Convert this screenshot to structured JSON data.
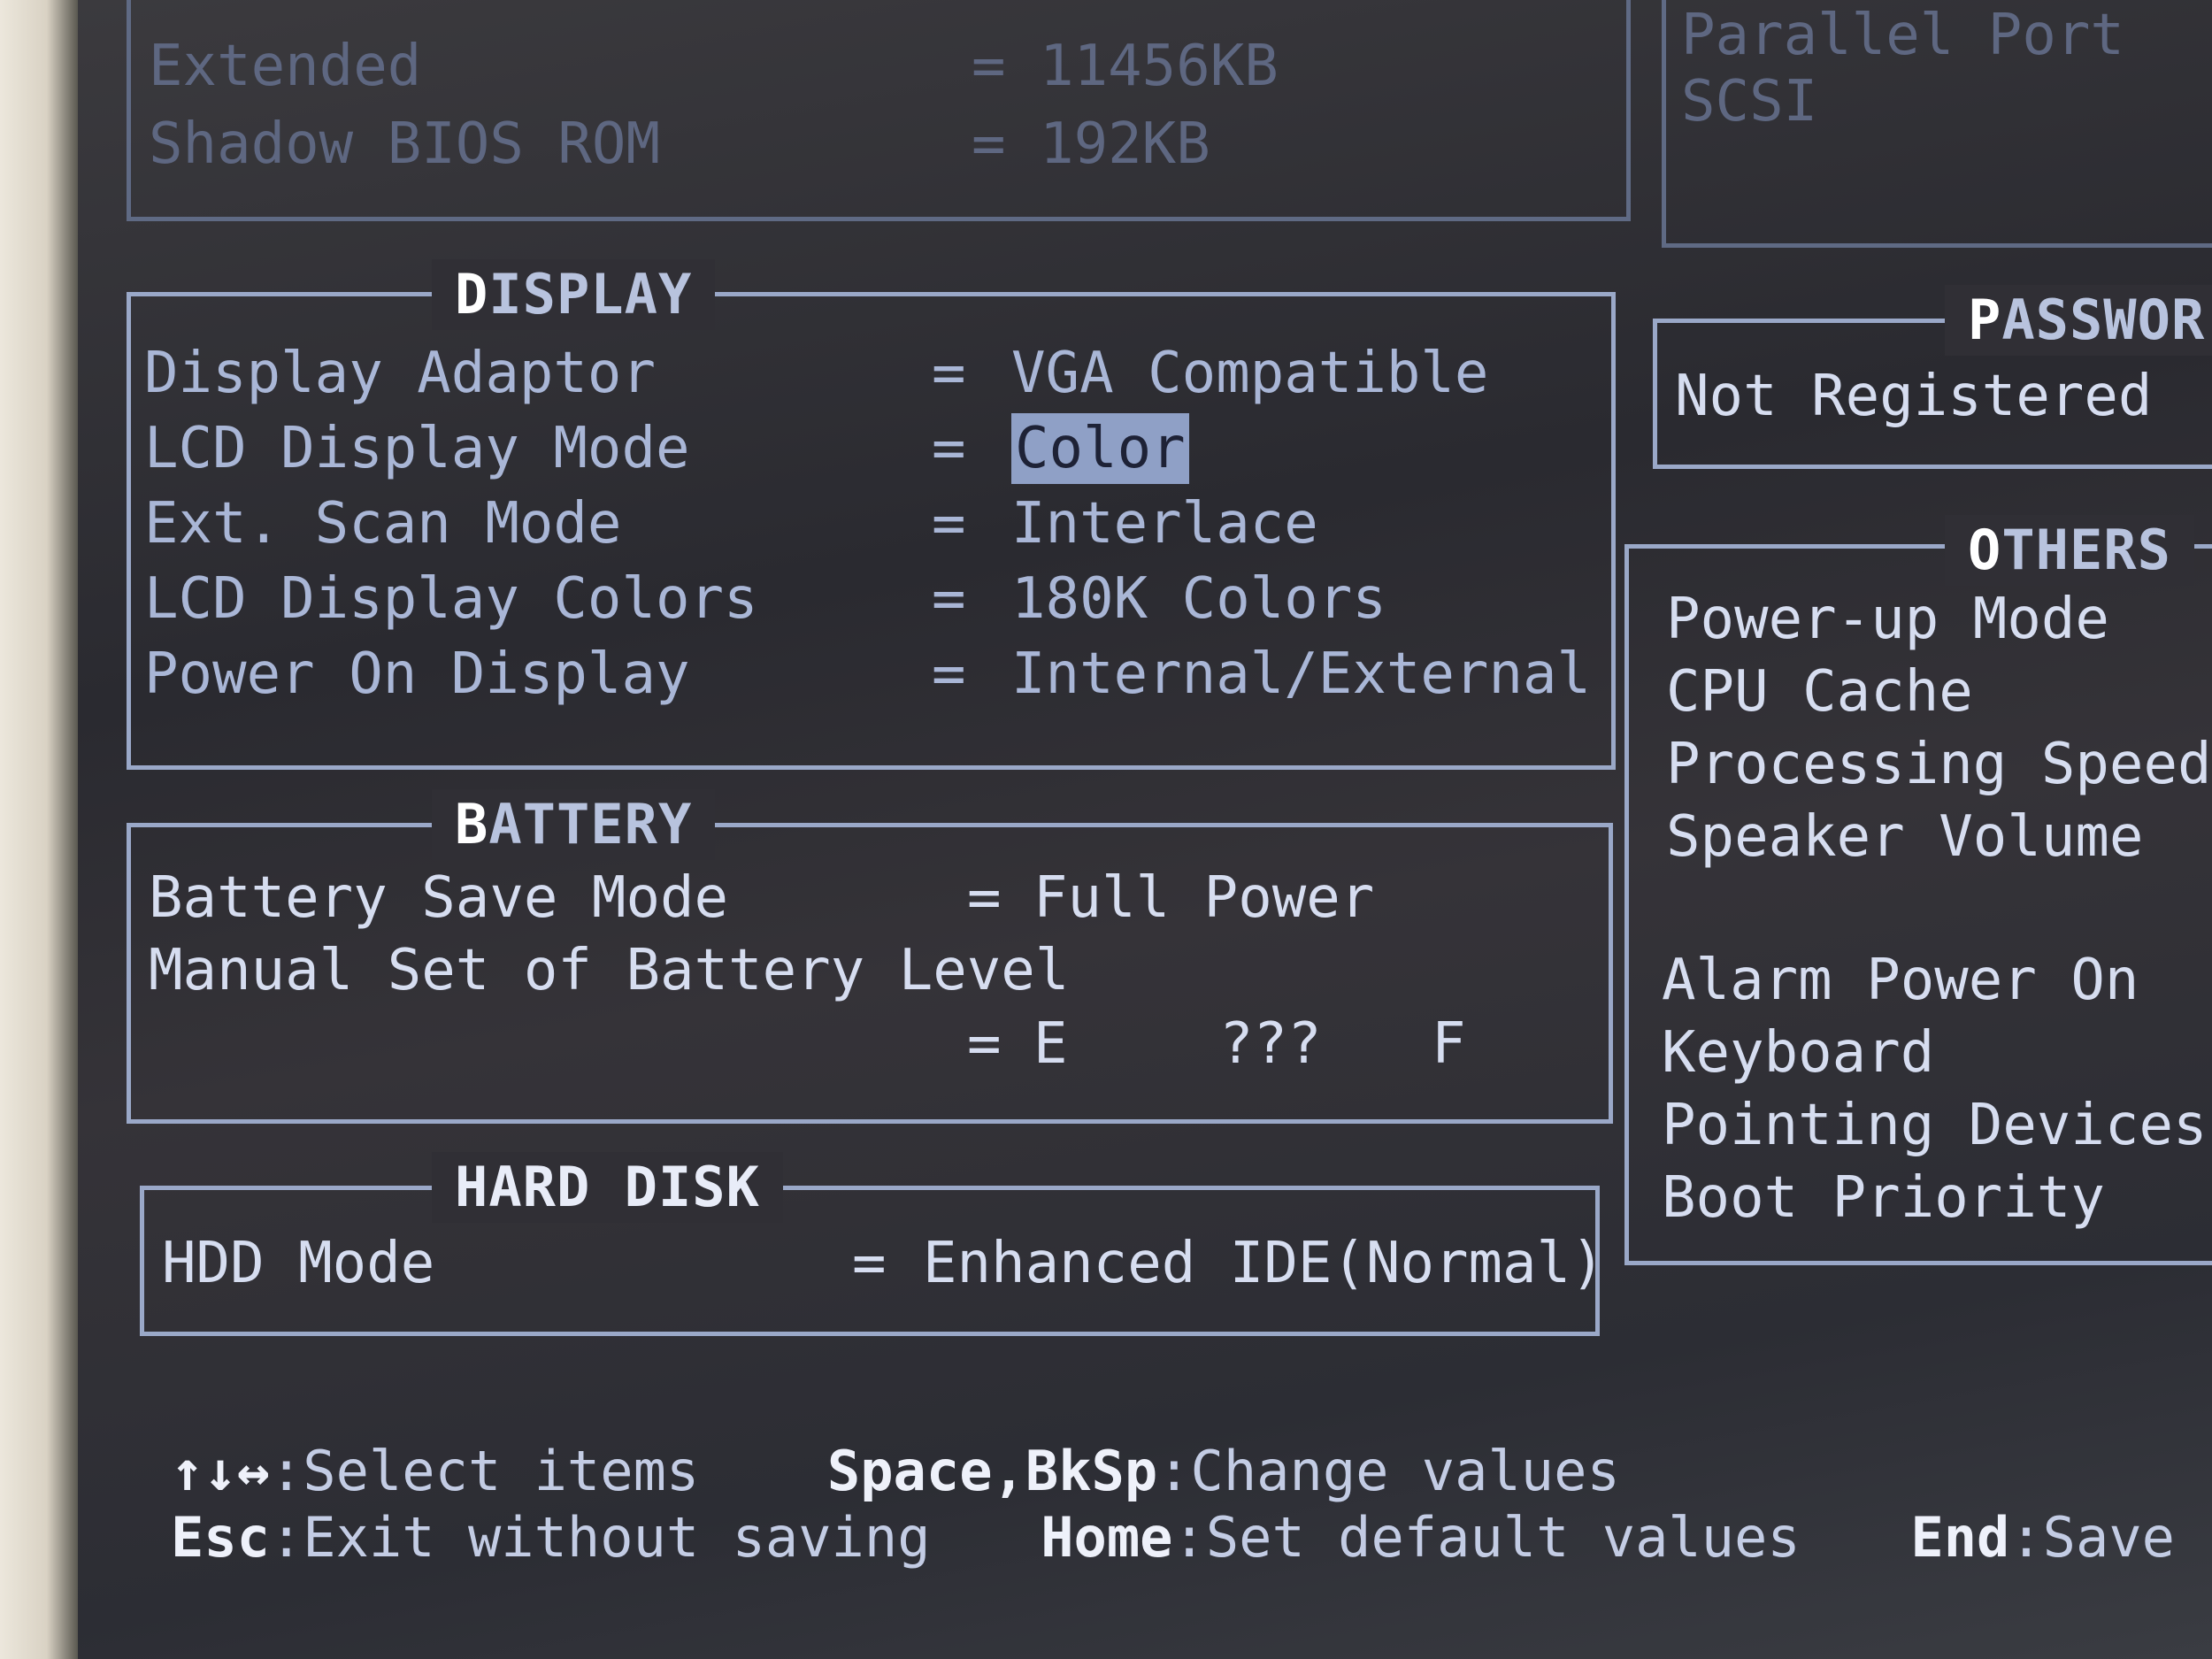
{
  "memory": {
    "rows": [
      {
        "label": "Extended",
        "value": "= 11456KB"
      },
      {
        "label": "Shadow BIOS ROM",
        "value": "=   192KB"
      }
    ]
  },
  "ports": {
    "items": [
      "Parallel Port",
      "SCSI"
    ]
  },
  "display": {
    "title_first": "D",
    "title_rest": "ISPLAY",
    "rows": [
      {
        "label": "Display Adaptor",
        "value": "VGA Compatible"
      },
      {
        "label": "LCD Display Mode",
        "value": "Color"
      },
      {
        "label": "Ext. Scan Mode",
        "value": "Interlace"
      },
      {
        "label": "LCD Display Colors",
        "value": "180K Colors"
      },
      {
        "label": "Power On Display",
        "value": "Internal/External"
      }
    ]
  },
  "password": {
    "title_first": "P",
    "title_rest": "ASSWOR",
    "status": "Not Registered"
  },
  "others": {
    "title_first": "O",
    "title_rest": "THERS",
    "items": [
      "Power-up Mode",
      "CPU Cache",
      "Processing Speed",
      "Speaker Volume",
      "Alarm Power On",
      "Keyboard",
      "Pointing Devices",
      "Boot Priority"
    ]
  },
  "battery": {
    "title_first": "B",
    "title_rest": "ATTERY",
    "save_mode_label": "Battery Save Mode",
    "save_mode_value": "Full Power",
    "manual_label": "Manual Set of Battery Level",
    "level_empty": "E",
    "level_value": "???",
    "level_full": "F"
  },
  "harddisk": {
    "title": "HARD DISK",
    "label": "HDD Mode",
    "value": "Enhanced IDE(Normal)"
  },
  "equals": "=",
  "help": {
    "arrows_key": "↑↓↔",
    "arrows_desc": ":Select items",
    "space_key": "Space,BkSp",
    "space_desc": ":Change values",
    "esc_key": "Esc",
    "esc_desc": ":Exit without saving",
    "home_key": "Home",
    "home_desc": ":Set default values",
    "end_key": "End",
    "end_desc": ":Save"
  },
  "colors": {
    "text": "#a9b6d6",
    "highlight": "#8fa0c6",
    "border": "#9aa8c8",
    "background": "#2e2e34"
  }
}
